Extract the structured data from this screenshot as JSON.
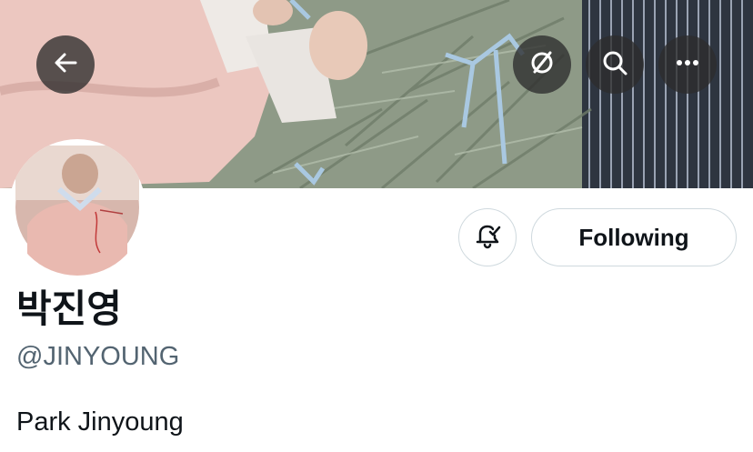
{
  "header": {
    "back_icon": "arrow-left-icon",
    "translate_icon": "slashed-circle-icon",
    "search_icon": "search-icon",
    "more_icon": "more-horizontal-icon"
  },
  "profile": {
    "display_name": "박진영",
    "handle": "@JINYOUNG",
    "bio": "Park Jinyoung"
  },
  "actions": {
    "notifications_icon": "bell-check-icon",
    "follow_label": "Following"
  }
}
